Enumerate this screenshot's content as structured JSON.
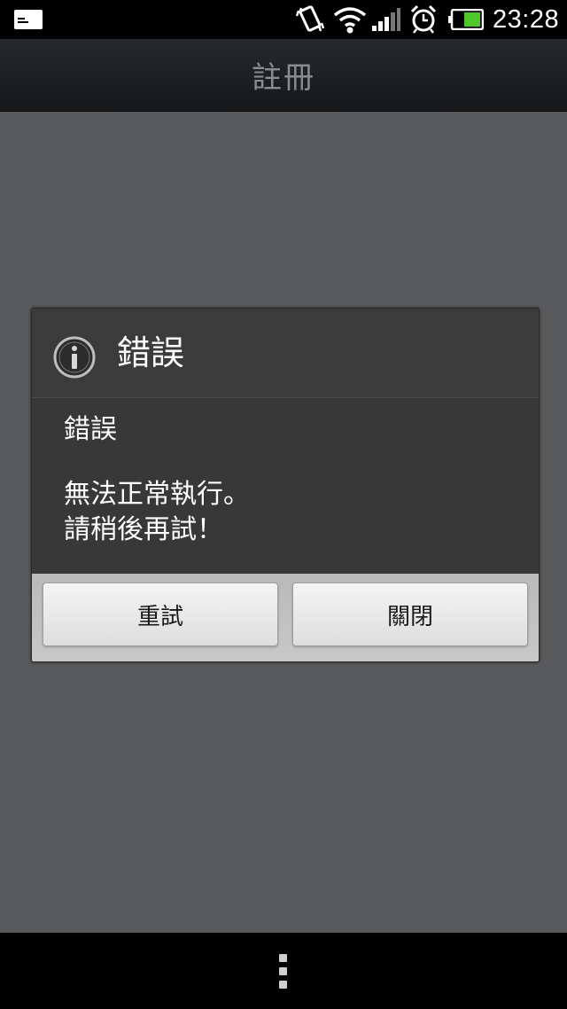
{
  "status_bar": {
    "time": "23:28",
    "icons": [
      "notification-icon",
      "vibrate-icon",
      "wifi-icon",
      "signal-icon",
      "alarm-icon",
      "battery-icon"
    ]
  },
  "title_bar": {
    "title": "註冊"
  },
  "dialog": {
    "icon": "info-icon",
    "title": "錯誤",
    "message_heading": "錯誤",
    "message_line_1": "無法正常執行。",
    "message_line_2": "請稍後再試！",
    "retry_label": "重試",
    "close_label": "關閉"
  },
  "nav_bar": {
    "menu_icon": "menu-icon"
  },
  "colors": {
    "background": "#58595b",
    "dialog_bg": "#3a3a3a",
    "button_bg": "#eaeaea",
    "battery_fill": "#4fc72a"
  }
}
